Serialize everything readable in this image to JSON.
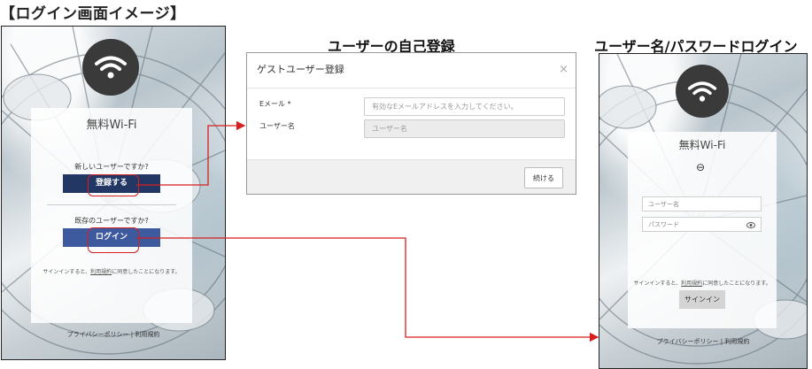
{
  "page_title": "【ログイン画面イメージ】",
  "headings": {
    "registration": "ユーザーの自己登録",
    "login": "ユーザー名/パスワードログイン"
  },
  "left_screen": {
    "card_title": "無料Wi-Fi",
    "new_user_prompt": "新しいユーザーですか?",
    "register_label": "登録する",
    "existing_user_prompt": "既存のユーザーですか?",
    "login_label": "ログイン",
    "terms_prefix": "サインインすると、",
    "terms_link": "利用規約",
    "terms_suffix": "に同意したことになります。",
    "footer": "プライバシーポリシー | 利用規約"
  },
  "dialog": {
    "title": "ゲストユーザー登録",
    "close": "×",
    "email_label": "Eメール *",
    "email_placeholder": "有効なEメールアドレスを入力してください。",
    "username_label": "ユーザー名",
    "username_placeholder": "ユーザー名",
    "continue_label": "続ける"
  },
  "right_screen": {
    "card_title": "無料Wi-Fi",
    "back_icon": "⊖",
    "username_placeholder": "ユーザー名",
    "password_placeholder": "パスワード",
    "terms_prefix": "サインインすると、",
    "terms_link": "利用規約",
    "terms_suffix": "に同意したことになります。",
    "signin_label": "サインイン",
    "footer": "プライバシーポリシー | 利用規約"
  },
  "colors": {
    "register_button": "#223763",
    "login_button": "#3d5a9f",
    "highlight": "#d61f1f"
  }
}
